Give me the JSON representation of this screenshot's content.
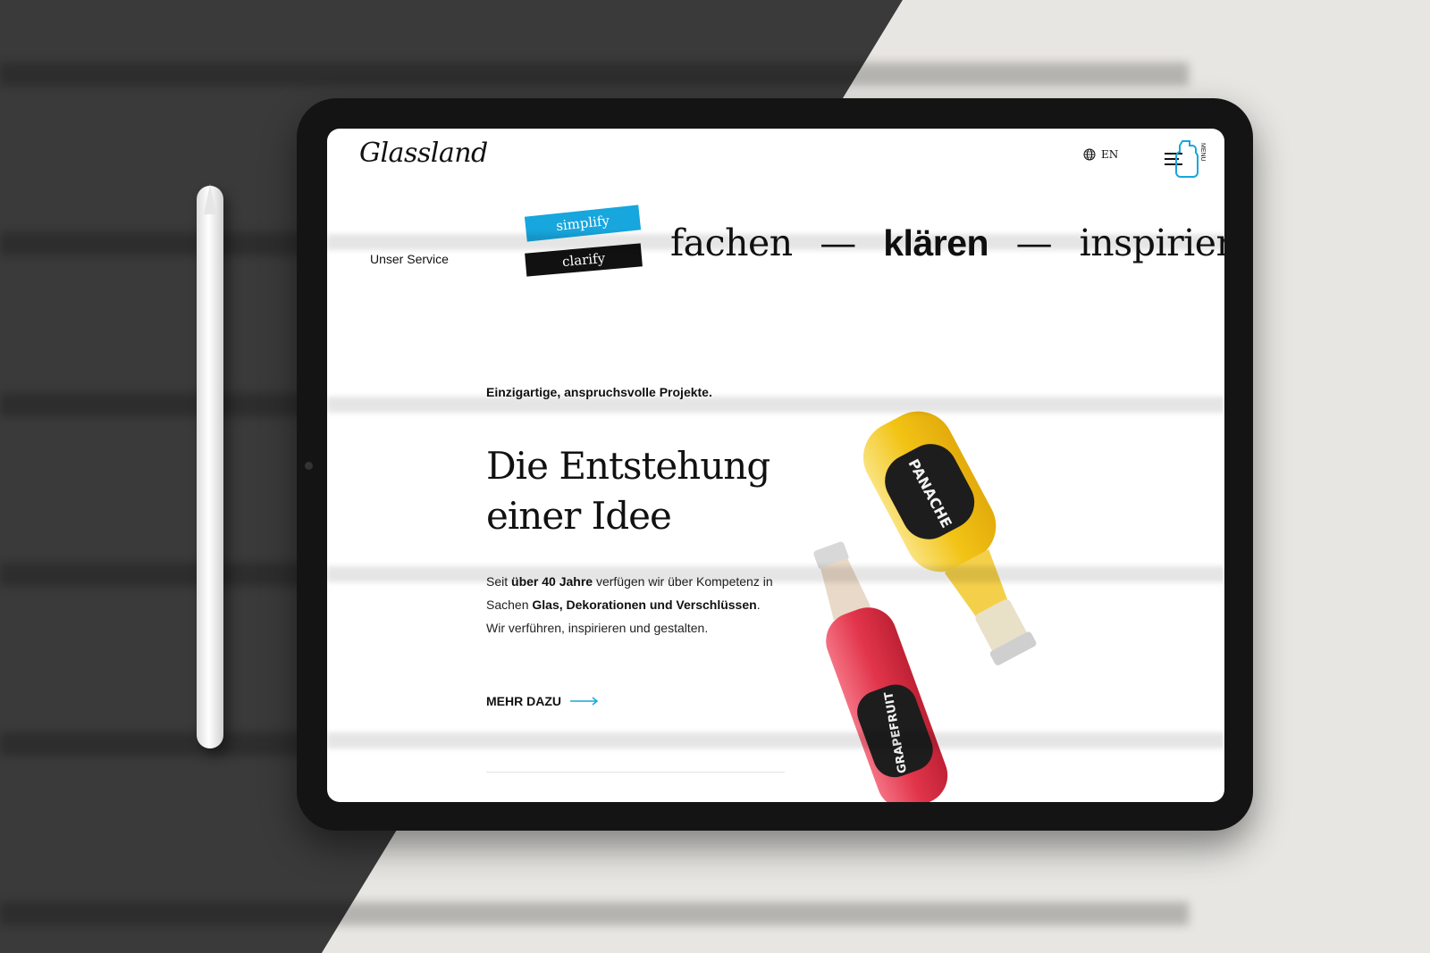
{
  "site": {
    "logo": "Glassland",
    "lang": "EN",
    "menu_label": "MENU"
  },
  "hero": {
    "service_label": "Unser Service",
    "tag_simplify": "simplify",
    "tag_clarify": "clarify",
    "word1": "fachen",
    "dash": "—",
    "word2": "klären",
    "word3": "inspirieren"
  },
  "content": {
    "subhead": "Einzigartige, anspruchsvolle Projekte.",
    "headline_line1": "Die Entstehung",
    "headline_line2": "einer Idee",
    "para_1a": "Seit ",
    "para_1b": "über 40 Jahre",
    "para_1c": " verfügen wir über Kompetenz in Sachen ",
    "para_1d": "Glas, Dekorationen und Verschlüssen",
    "para_1e": ".",
    "para_2": "Wir verführen, inspirieren und gestalten.",
    "more_label": "MEHR DAZU"
  },
  "products": {
    "bottle1_label": "PANACHE",
    "bottle2_label": "GRAPEFRUIT"
  },
  "colors": {
    "accent_blue": "#17a6dd",
    "text": "#111111"
  }
}
